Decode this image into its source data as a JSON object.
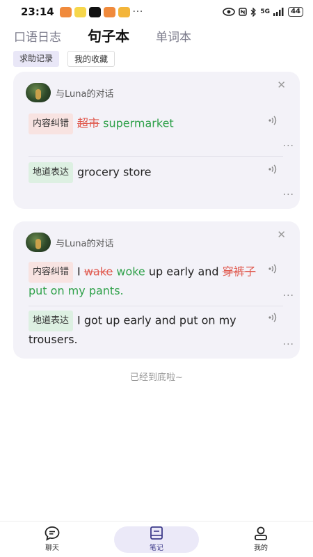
{
  "status": {
    "time": "23:14",
    "dots": "···",
    "signal": "5G",
    "battery": "44"
  },
  "tabs": [
    "口语日志",
    "句子本",
    "单词本"
  ],
  "filters": [
    "求助记录",
    "我的收藏"
  ],
  "cards": [
    {
      "title": "与Luna的对话",
      "correction": {
        "tag": "内容纠错",
        "wrong_1": "超市",
        "right_1": "supermarket"
      },
      "native": {
        "tag": "地道表达",
        "text": "grocery store"
      }
    },
    {
      "title": "与Luna的对话",
      "correction": {
        "tag": "内容纠错",
        "prefix": "I",
        "wrong_1": "wake",
        "right_1": "woke",
        "mid": "up early and",
        "wrong_2": "穿裤子",
        "right_2": "put on my pants."
      },
      "native": {
        "tag": "地道表达",
        "text": "I got up early and put on my trousers."
      }
    }
  ],
  "end_text": "已经到底啦~",
  "nav": [
    {
      "label": "聊天",
      "icon": "chat-bubble-icon"
    },
    {
      "label": "笔记",
      "icon": "notebook-icon"
    },
    {
      "label": "我的",
      "icon": "person-icon"
    }
  ],
  "colors": {
    "accent_bg": "#ebe9f8",
    "wrong": "#e05a4f",
    "right": "#2fa14a"
  }
}
